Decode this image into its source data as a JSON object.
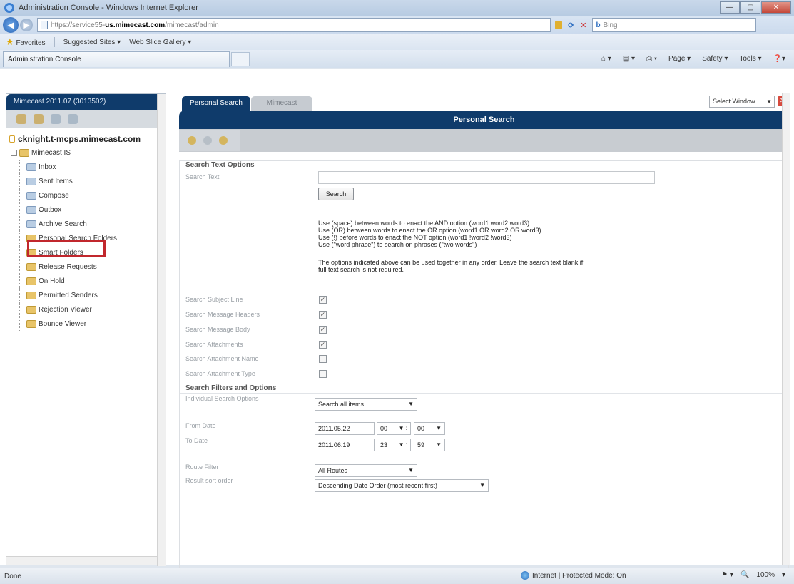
{
  "window": {
    "title": "Administration Console - Windows Internet Explorer",
    "buttons": [
      "—",
      "▢",
      "✕"
    ]
  },
  "address": {
    "url_prefix": "https://service55-",
    "url_host": "us.mimecast.com",
    "url_suffix": "/mimecast/admin",
    "search_placeholder": "Bing"
  },
  "favorites": {
    "label": "Favorites",
    "items": [
      "Suggested Sites ▾",
      "Web Slice Gallery ▾"
    ]
  },
  "browser_tab": {
    "label": "Administration Console"
  },
  "commands": [
    "Page ▾",
    "Safety ▾",
    "Tools ▾"
  ],
  "left": {
    "account": "Mimecast 2011.07 (3013502)",
    "mailbox": "cknight.t-mcps.mimecast.com",
    "tree": [
      {
        "label": "Mimecast IS",
        "type": "root"
      },
      {
        "label": "Inbox",
        "type": "blue"
      },
      {
        "label": "Sent Items",
        "type": "blue"
      },
      {
        "label": "Compose",
        "type": "blue"
      },
      {
        "label": "Outbox",
        "type": "blue"
      },
      {
        "label": "Archive Search",
        "type": "blue"
      },
      {
        "label": "Personal Search Folders",
        "type": "yellow"
      },
      {
        "label": "Smart Folders",
        "type": "yellow"
      },
      {
        "label": "Release Requests",
        "type": "yellow"
      },
      {
        "label": "On Hold",
        "type": "yellow"
      },
      {
        "label": "Permitted Senders",
        "type": "yellow"
      },
      {
        "label": "Rejection Viewer",
        "type": "yellow"
      },
      {
        "label": "Bounce Viewer",
        "type": "yellow"
      }
    ]
  },
  "tabs": {
    "active": "Personal Search",
    "inactive": "Mimecast",
    "select_window": "Select Window..."
  },
  "banner": "Personal Search",
  "form": {
    "section1": "Search Text Options",
    "search_text_label": "Search Text",
    "search_button": "Search",
    "help_lines": [
      "Use (space) between words to enact the AND option (word1 word2 word3)",
      "Use (OR) between words to enact the OR option (word1 OR word2 OR word3)",
      "Use (!) before words to enact the NOT option (word1 !word2 !word3)",
      "Use (\"word phrase\") to search on phrases (\"two words\")"
    ],
    "help_note_1": "The options indicated above can be used together in any order. Leave the search text blank if",
    "help_note_2": "full text search is not required.",
    "checkboxes": [
      {
        "label": "Search Subject Line",
        "checked": "✓"
      },
      {
        "label": "Search Message Headers",
        "checked": "✓"
      },
      {
        "label": "Search Message Body",
        "checked": "✓"
      },
      {
        "label": "Search Attachments",
        "checked": "✓"
      },
      {
        "label": "Search Attachment Name",
        "checked": ""
      },
      {
        "label": "Search Attachment Type",
        "checked": ""
      }
    ],
    "section2": "Search Filters and Options",
    "individual_label": "Individual Search Options",
    "individual_value": "Search all items",
    "from_label": "From Date",
    "from_date": "2011.05.22",
    "from_hour": "00",
    "from_min": "00",
    "to_label": "To Date",
    "to_date": "2011.06.19",
    "to_hour": "23",
    "to_min": "59",
    "route_label": "Route Filter",
    "route_value": "All Routes",
    "sort_label": "Result sort order",
    "sort_value": "Descending Date Order (most recent first)"
  },
  "status": {
    "left": "Done",
    "zone": "Internet | Protected Mode: On",
    "zoom": "100%"
  }
}
